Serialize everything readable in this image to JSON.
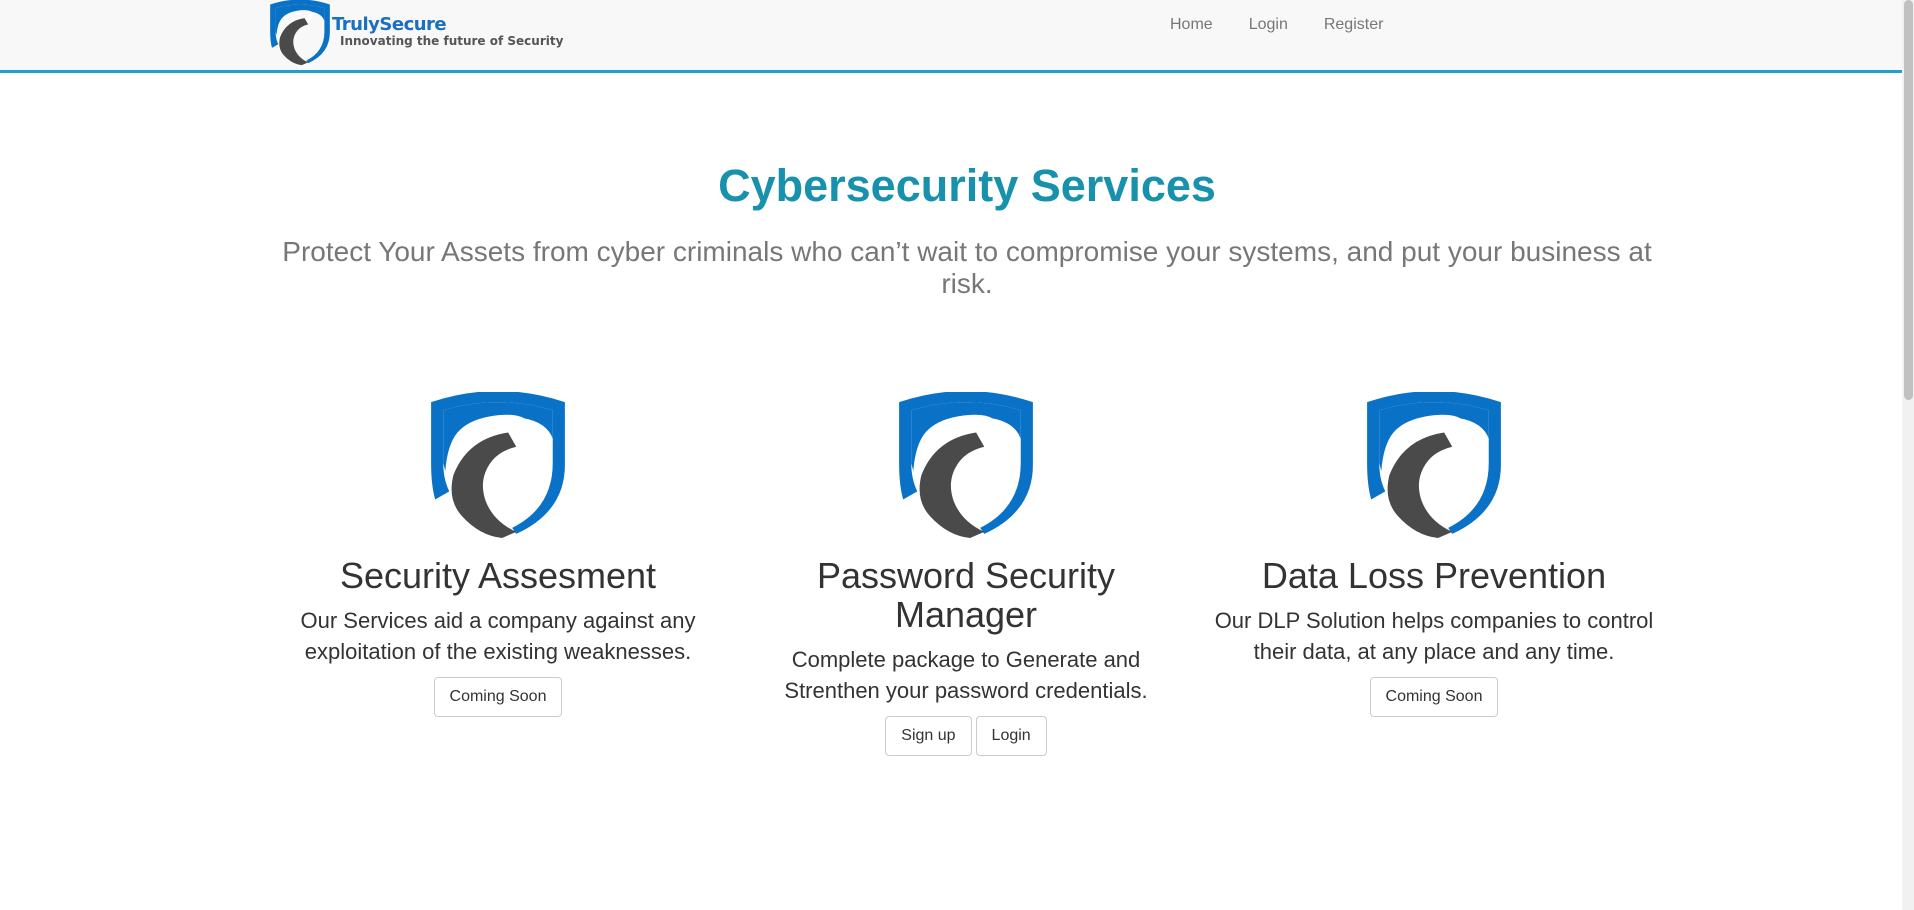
{
  "navbar": {
    "brand_name": "TrulySecure",
    "brand_tagline": "Innovating the future of Security",
    "links": [
      "Home",
      "Login",
      "Register"
    ]
  },
  "hero": {
    "title": "Cybersecurity Services",
    "subtitle": "Protect Your Assets from cyber criminals who can’t wait to compromise your systems, and put your business at risk."
  },
  "services": [
    {
      "icon": "eagle-shield-icon",
      "title": "Security Assesment",
      "description": "Our Services aid a company against any exploitation of the existing weaknesses.",
      "buttons": [
        "Coming Soon"
      ]
    },
    {
      "icon": "eagle-shield-icon",
      "title": "Password Security Manager",
      "description": "Complete package to Generate and Strenthen your password credentials.",
      "buttons": [
        "Sign up",
        "Login"
      ]
    },
    {
      "icon": "eagle-shield-icon",
      "title": "Data Loss Prevention",
      "description": "Our DLP Solution helps companies to control their data, at any place and any time.",
      "buttons": [
        "Coming Soon"
      ]
    }
  ],
  "colors": {
    "brand_blue": "#0a72c6",
    "eagle_gray": "#4a4a4a",
    "accent_teal": "#1892ac",
    "navbar_border": "#1fa0cf"
  }
}
